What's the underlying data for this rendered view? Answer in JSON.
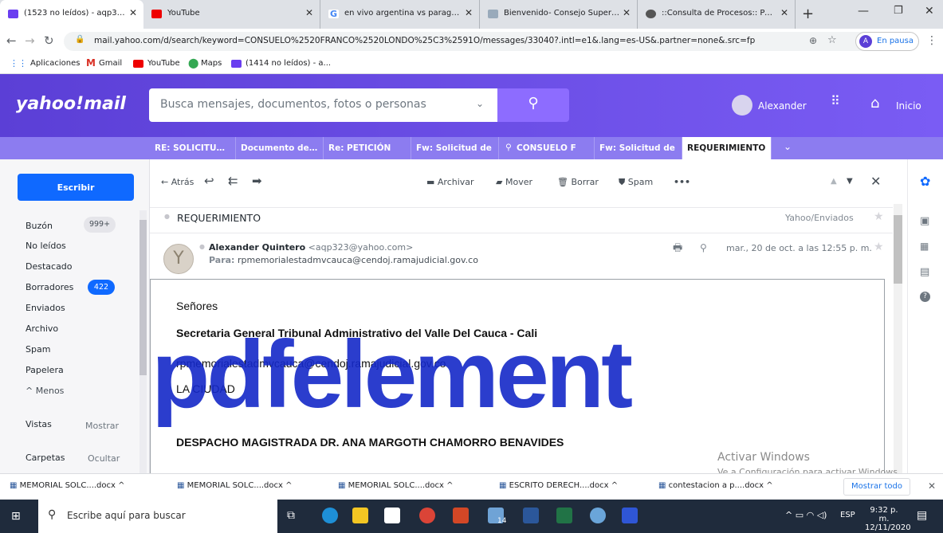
{
  "browser": {
    "tabs": [
      {
        "label": "(1523 no leídos) - aqp323@ya"
      },
      {
        "label": "YouTube"
      },
      {
        "label": "en vivo argentina vs paraguay"
      },
      {
        "label": "Bienvenido- Consejo Superior"
      },
      {
        "label": "::Consulta de Procesos:: Págin"
      }
    ],
    "url": "mail.yahoo.com/d/search/keyword=CONSUELO%2520FRANCO%2520LONDO%25C3%2591O/messages/33040?.intl=e1&.lang=es-US&.partner=none&.src=fp",
    "profile_status": "En pausa",
    "bookmarks": [
      "Aplicaciones",
      "Gmail",
      "YouTube",
      "Maps",
      "(1414 no leídos) - a..."
    ]
  },
  "yahoo": {
    "logo": "yahoo!mail",
    "search_placeholder": "Busca mensajes, documentos, fotos o personas",
    "user": "Alexander",
    "home": "Inicio",
    "tabs": [
      "RE: SOLICITUD D",
      "Documento de A",
      "Re: PETICIÓN",
      "Fw: Solicitud de",
      "CONSUELO F",
      "Fw: Solicitud de",
      "REQUERIMIENTO"
    ],
    "compose": "Escribir",
    "folders": [
      {
        "label": "Buzón",
        "badge": "999+"
      },
      {
        "label": "No leídos"
      },
      {
        "label": "Destacado"
      },
      {
        "label": "Borradores",
        "badge": "422"
      },
      {
        "label": "Enviados"
      },
      {
        "label": "Archivo"
      },
      {
        "label": "Spam"
      },
      {
        "label": "Papelera"
      },
      {
        "label": "Menos"
      }
    ],
    "views": {
      "label": "Vistas",
      "action": "Mostrar"
    },
    "carpetas": {
      "label": "Carpetas",
      "action": "Ocultar"
    },
    "toolbar": {
      "back": "Atrás",
      "archive": "Archivar",
      "move": "Mover",
      "delete": "Borrar",
      "spam": "Spam"
    },
    "message": {
      "subject": "REQUERIMIENTO",
      "folder": "Yahoo/Enviados",
      "from_name": "Alexander Quintero",
      "from_email": "<aqp323@yahoo.com>",
      "to_label": "Para:",
      "to": "rpmemorialestadmvcauca@cendoj.ramajudicial.gov.co",
      "date": "mar., 20 de oct. a las 12:55 p. m.",
      "body": [
        "Señores",
        "Secretaria General Tribunal Administrativo del Valle Del Cauca - Cali",
        "rpmemorialestadmvcauca@cendoj.ramajudicial.gov.co",
        "LA CIUDAD",
        "DESPACHO MAGISTRADA DR. ANA MARGOTH CHAMORRO BENAVIDES"
      ]
    }
  },
  "downloads": {
    "items": [
      "MEMORIAL SOLC....docx",
      "MEMORIAL SOLC....docx",
      "MEMORIAL SOLC....docx",
      "ESCRITO DERECH....docx",
      "contestacion a p....docx"
    ],
    "show_all": "Mostrar todo"
  },
  "watermark": {
    "brand": "pdfelement",
    "activate_title": "Activar Windows",
    "activate_sub": "Ve a Configuración para activar Windows."
  },
  "taskbar": {
    "search": "Escribe aquí para buscar",
    "lang": "ESP",
    "time": "9:32 p. m.",
    "date": "12/11/2020",
    "badge": "14"
  }
}
